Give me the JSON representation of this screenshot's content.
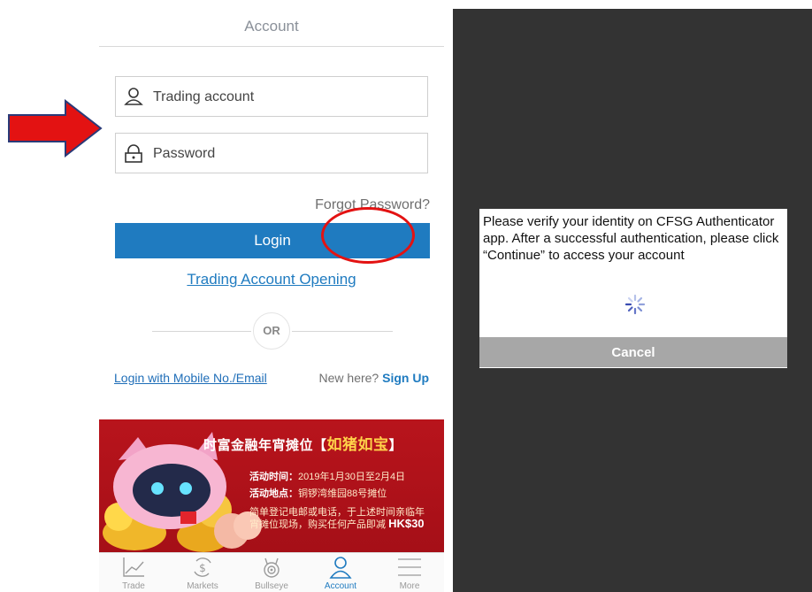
{
  "header": {
    "title": "Account"
  },
  "form": {
    "account_placeholder": "Trading account",
    "password_placeholder": "Password",
    "forgot_label": "Forgot Password?",
    "login_label": "Login",
    "opening_label": "Trading Account Opening",
    "or_label": "OR",
    "alt_login_label": "Login with Mobile No./Email",
    "new_here_label": "New here?",
    "sign_up_label": "Sign Up"
  },
  "banner": {
    "title_prefix": "时富金融年宵摊位【",
    "title_highlight": "如猪如宝",
    "title_suffix": "】",
    "time_label": "活动时间：",
    "time_value": "2019年1月30日至2月4日",
    "place_label": "活动地点：",
    "place_value": "铜锣湾维园88号摊位",
    "line3": "简单登记电邮或电话，于上述时间亲临年",
    "line4_text": "宵摊位现场，购买任何产品即减",
    "line4_amount": "HK$30"
  },
  "tabs": [
    {
      "label": "Trade",
      "icon": "chart-icon"
    },
    {
      "label": "Markets",
      "icon": "markets-icon"
    },
    {
      "label": "Bullseye",
      "icon": "bullseye-icon"
    },
    {
      "label": "Account",
      "icon": "person-icon"
    },
    {
      "label": "More",
      "icon": "menu-icon"
    }
  ],
  "dialog": {
    "message": "Please verify your identity on CFSG Authenticator app. After a successful authentication, please click “Continue” to access your account",
    "cancel_label": "Cancel"
  },
  "colors": {
    "accent": "#1f7bc0",
    "annotation": "#e31212",
    "dark_bg": "#333333",
    "banner_red": "#b8141c"
  }
}
